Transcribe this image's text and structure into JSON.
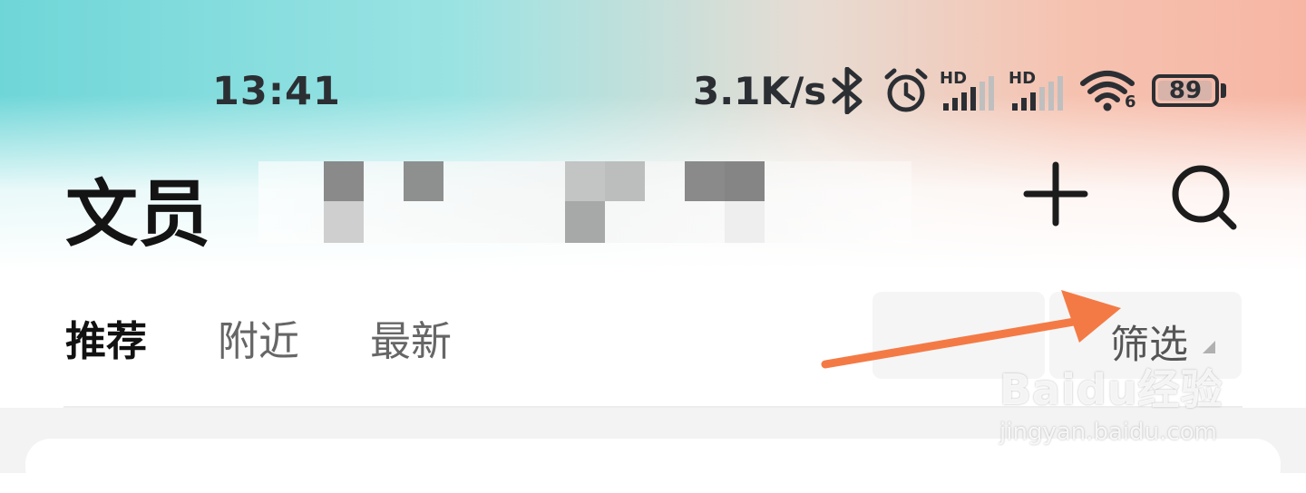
{
  "status_bar": {
    "time": "13:41",
    "net_speed": "3.1K/s",
    "battery": "89",
    "wifi_label": "6",
    "hd_label_1": "HD",
    "hd_label_2": "HD",
    "icons": [
      "bluetooth-icon",
      "alarm-icon",
      "signal-icon",
      "signal-icon",
      "wifi-icon",
      "battery-icon"
    ]
  },
  "header": {
    "title": "文员",
    "add_icon": "add-icon",
    "search_icon": "search-icon"
  },
  "tabs": [
    {
      "label": "推荐",
      "active": true
    },
    {
      "label": "附近",
      "active": false
    },
    {
      "label": "最新",
      "active": false
    }
  ],
  "filter": {
    "label": "筛选"
  },
  "watermark": {
    "logo": "Baidu经验",
    "url": "jingyan.baidu.com"
  },
  "colors": {
    "accent_arrow": "#f47a45",
    "text_dark": "#141414",
    "tab_inactive": "#666666"
  }
}
